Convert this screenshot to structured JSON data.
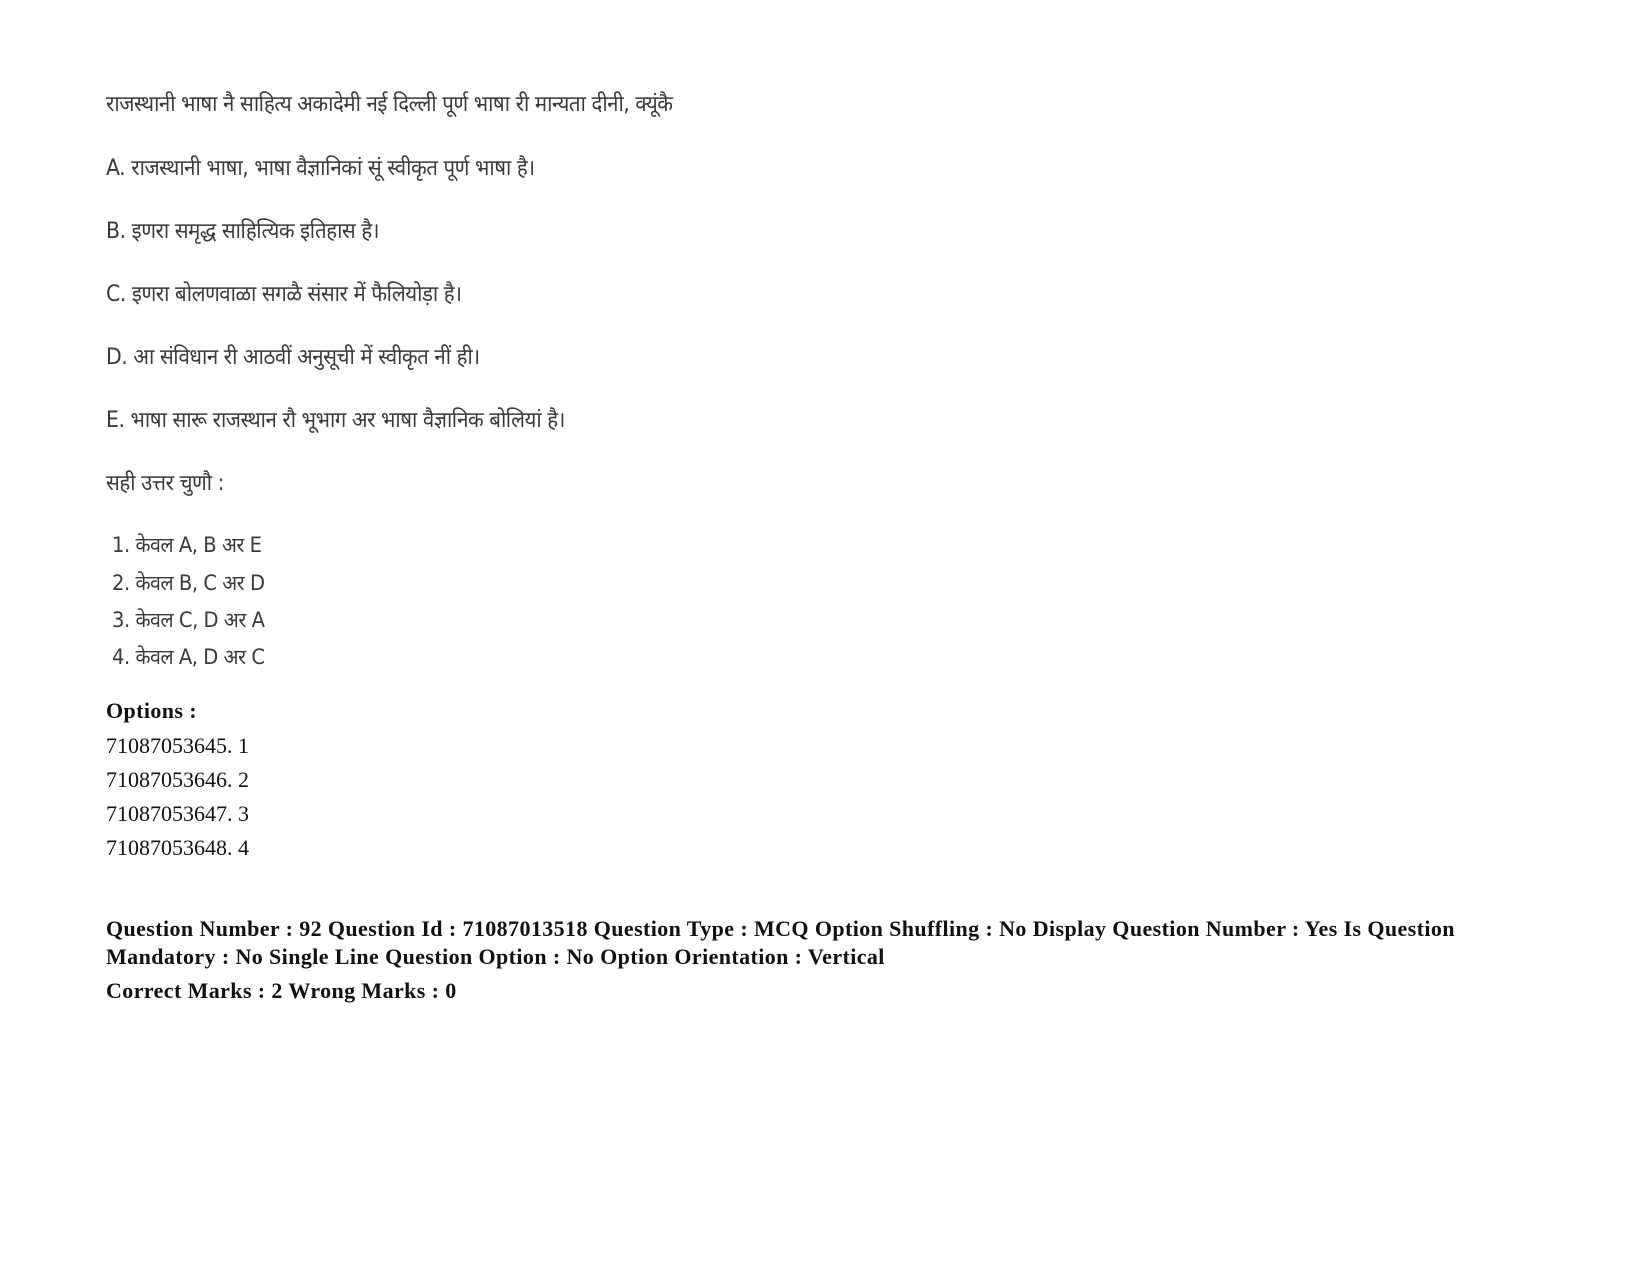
{
  "question": {
    "stem": "राजस्थानी भाषा नै साहित्य अकादेमी नई दिल्ली पूर्ण भाषा री मान्यता दीनी, क्यूंकै",
    "statements": [
      "A. राजस्थानी भाषा, भाषा वैज्ञानिकां सूं स्वीकृत पूर्ण भाषा है।",
      "B. इणरा समृद्ध साहित्यिक इतिहास है।",
      "C. इणरा बोलणवाळा सगळै संसार में फैलियोड़ा है।",
      "D. आ संविधान री आठवीं अनुसूची में स्वीकृत नीं ही।",
      "E.  भाषा सारू राजस्थान रौ भूभाग अर भाषा वैज्ञानिक बोलियां है।"
    ],
    "prompt": "सही उत्तर चुणौ  :",
    "choices": [
      "1. केवल A, B अर E",
      "2. केवल B, C अर D",
      "3. केवल C, D अर A",
      "4. केवल A, D अर C"
    ]
  },
  "options": {
    "heading": "Options :",
    "items": [
      "71087053645. 1",
      "71087053646. 2",
      "71087053647. 3",
      "71087053648. 4"
    ]
  },
  "metadata": {
    "details": "Question Number : 92 Question Id : 71087013518 Question Type : MCQ Option Shuffling : No Display Question Number : Yes Is Question Mandatory : No Single Line Question Option : No Option Orientation : Vertical",
    "marks": "Correct Marks : 2 Wrong Marks : 0"
  }
}
